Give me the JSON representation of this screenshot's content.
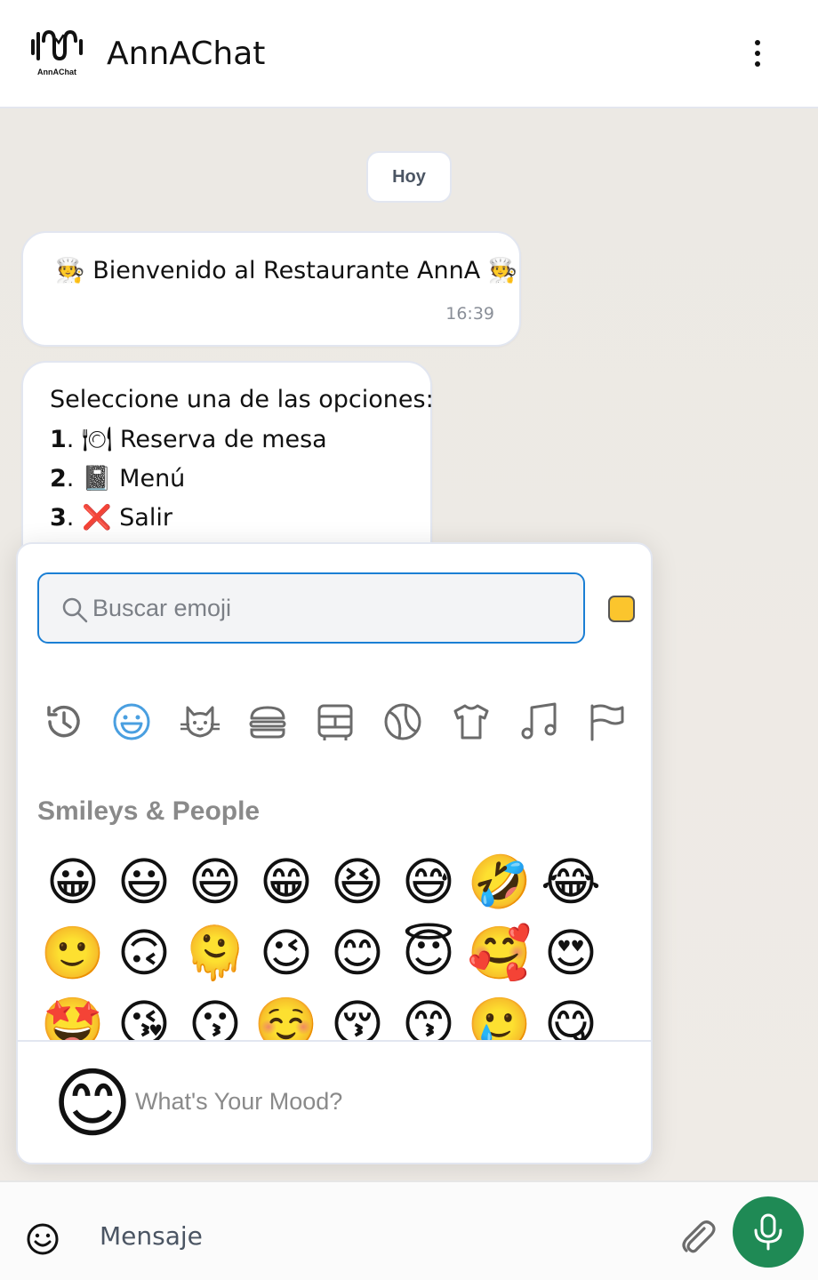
{
  "header": {
    "title": "AnnAChat",
    "logo_text": "AnnAChat",
    "menu_icon": "kebab-menu-icon"
  },
  "chat": {
    "date_chip": "Hoy",
    "messages": [
      {
        "text": "🧑‍🍳 Bienvenido al Restaurante AnnA 🧑‍🍳",
        "time": "16:39"
      },
      {
        "intro": "Seleccione una de las opciones:",
        "options": [
          {
            "num": "1",
            "text": ". 🍽 Reserva de mesa"
          },
          {
            "num": "2",
            "text": ". 📓 Menú"
          },
          {
            "num": "3",
            "text": ". ❌ Salir"
          }
        ]
      }
    ]
  },
  "emoji_picker": {
    "search_placeholder": "Buscar emoji",
    "skin_tone_color": "#fbc52d",
    "categories": [
      "recent-icon",
      "smileys-icon",
      "animals-icon",
      "food-icon",
      "travel-icon",
      "activities-icon",
      "objects-icon",
      "symbols-icon",
      "flags-icon"
    ],
    "active_category": "smileys-icon",
    "section_title": "Smileys & People",
    "emoji_rows": [
      [
        "😀",
        "😃",
        "😄",
        "😁",
        "😆",
        "😅",
        "🤣",
        "😂"
      ],
      [
        "🙂",
        "🙃",
        "🫠",
        "😉",
        "😊",
        "😇",
        "🥰",
        "😍"
      ],
      [
        "🤩",
        "😘",
        "😗",
        "☺️",
        "😚",
        "😙",
        "🥲",
        "😋"
      ]
    ],
    "preview_emoji": "😊",
    "preview_text": "What's Your Mood?"
  },
  "input_bar": {
    "placeholder": "Mensaje",
    "mic_color": "#1f8a55"
  }
}
